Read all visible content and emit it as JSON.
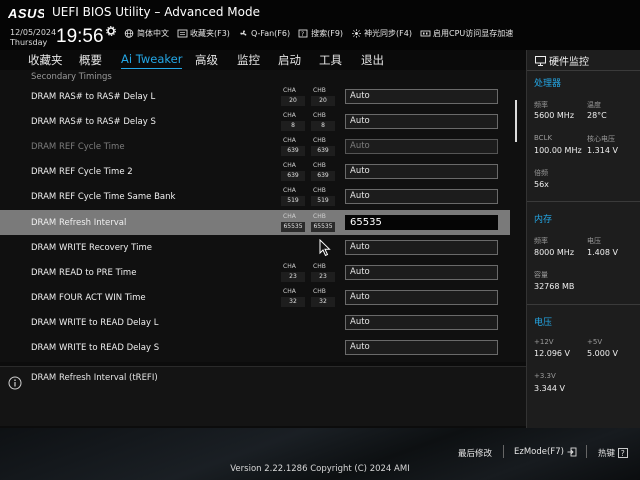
{
  "header": {
    "logo_text": "ASUS",
    "title": "UEFI BIOS Utility – Advanced Mode",
    "date": "12/05/2024",
    "day": "Thursday",
    "time": "19:56",
    "tools": [
      {
        "icon": "globe-icon",
        "label": "简体中文"
      },
      {
        "icon": "bookmark-icon",
        "label": "收藏夹(F3)"
      },
      {
        "icon": "fan-icon",
        "label": "Q-Fan(F6)"
      },
      {
        "icon": "search-icon",
        "label": "搜索(F9)"
      },
      {
        "icon": "aura-icon",
        "label": "神光同步(F4)"
      },
      {
        "icon": "memory-icon",
        "label": "启用CPU访问显存加速"
      }
    ]
  },
  "nav": {
    "tabs": [
      {
        "label": "收藏夹"
      },
      {
        "label": "概要"
      },
      {
        "label": "Ai Tweaker",
        "active": true
      },
      {
        "label": "高级"
      },
      {
        "label": "监控"
      },
      {
        "label": "启动"
      },
      {
        "label": "工具"
      },
      {
        "label": "退出"
      }
    ]
  },
  "main": {
    "section_title": "Secondary Timings",
    "channel_labels": {
      "a": "CHA",
      "b": "CHB"
    },
    "rows": [
      {
        "label": "DRAM RAS# to RAS# Delay L",
        "cha": "20",
        "chb": "20",
        "value": "Auto"
      },
      {
        "label": "DRAM RAS# to RAS# Delay S",
        "cha": "8",
        "chb": "8",
        "value": "Auto"
      },
      {
        "label": "DRAM REF Cycle Time",
        "cha": "639",
        "chb": "639",
        "value": "Auto",
        "dim": true
      },
      {
        "label": "DRAM REF Cycle Time 2",
        "cha": "639",
        "chb": "639",
        "value": "Auto"
      },
      {
        "label": "DRAM REF Cycle Time Same Bank",
        "cha": "519",
        "chb": "519",
        "value": "Auto"
      },
      {
        "label": "DRAM Refresh Interval",
        "cha": "65535",
        "chb": "65535",
        "value": "65535",
        "selected": true
      },
      {
        "label": "DRAM WRITE Recovery Time",
        "cha": "",
        "chb": "",
        "value": "Auto"
      },
      {
        "label": "DRAM READ to PRE Time",
        "cha": "23",
        "chb": "23",
        "value": "Auto"
      },
      {
        "label": "DRAM FOUR ACT WIN Time",
        "cha": "32",
        "chb": "32",
        "value": "Auto"
      },
      {
        "label": "DRAM WRITE to READ Delay L",
        "cha": "",
        "chb": "",
        "value": "Auto"
      },
      {
        "label": "DRAM WRITE to READ Delay S",
        "cha": "",
        "chb": "",
        "value": "Auto"
      }
    ]
  },
  "info": {
    "text": "DRAM Refresh Interval (tREFI)"
  },
  "hw_monitor": {
    "title": "硬件监控",
    "cpu": {
      "title": "处理器",
      "freq_label": "频率",
      "freq": "5600 MHz",
      "temp_label": "温度",
      "temp": "28°C",
      "bclk_label": "BCLK",
      "bclk": "100.00 MHz",
      "vcore_label": "核心电压",
      "vcore": "1.314 V",
      "ratio_label": "倍频",
      "ratio": "56x"
    },
    "memory": {
      "title": "内存",
      "freq_label": "频率",
      "freq": "8000 MHz",
      "volt_label": "电压",
      "volt": "1.408 V",
      "cap_label": "容量",
      "cap": "32768 MB"
    },
    "voltage": {
      "title": "电压",
      "v12_label": "+12V",
      "v12": "12.096 V",
      "v5_label": "+5V",
      "v5": "5.000 V",
      "v33_label": "+3.3V",
      "v33": "3.344 V"
    }
  },
  "footer": {
    "last_modified": "最后修改",
    "ezmode": "EzMode(F7)",
    "hotkeys": "热键",
    "version": "Version 2.22.1286 Copyright (C) 2024 AMI"
  },
  "colors": {
    "accent": "#24a7e6",
    "selected_row": "#7a7a7a"
  }
}
